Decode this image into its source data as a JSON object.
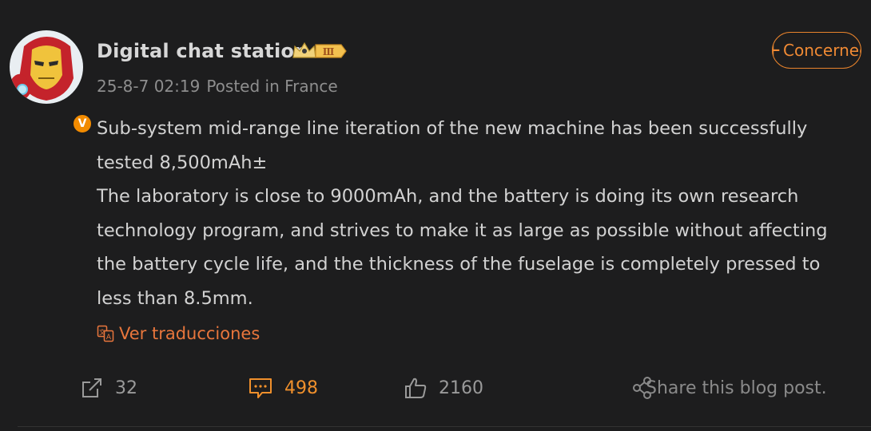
{
  "author": {
    "name": "Digital chat station",
    "badge_level": "Ⅲ",
    "verified_mark": "V",
    "timestamp": "25-8-7 02:19",
    "location": "Posted in France"
  },
  "follow_button": {
    "plus": "+",
    "label": "Concerned"
  },
  "post": {
    "paragraphs": [
      "Sub-system mid-range line iteration of the new machine has been successfully tested 8,500mAh±",
      "The laboratory is close to 9000mAh, and the battery is doing its own research technology program, and strives to make it as large as possible without affecting the battery cycle life, and the thickness of the fuselage is completely pressed to less than 8.5mm."
    ],
    "translate_label": "Ver traducciones"
  },
  "actions": {
    "repost_count": "32",
    "comment_count": "498",
    "like_count": "2160",
    "share_label": "Share this blog post."
  },
  "colors": {
    "background": "#1d1d1e",
    "accent": "#f08a34",
    "text": "#d2d2d2",
    "muted": "#8e8e8e"
  }
}
